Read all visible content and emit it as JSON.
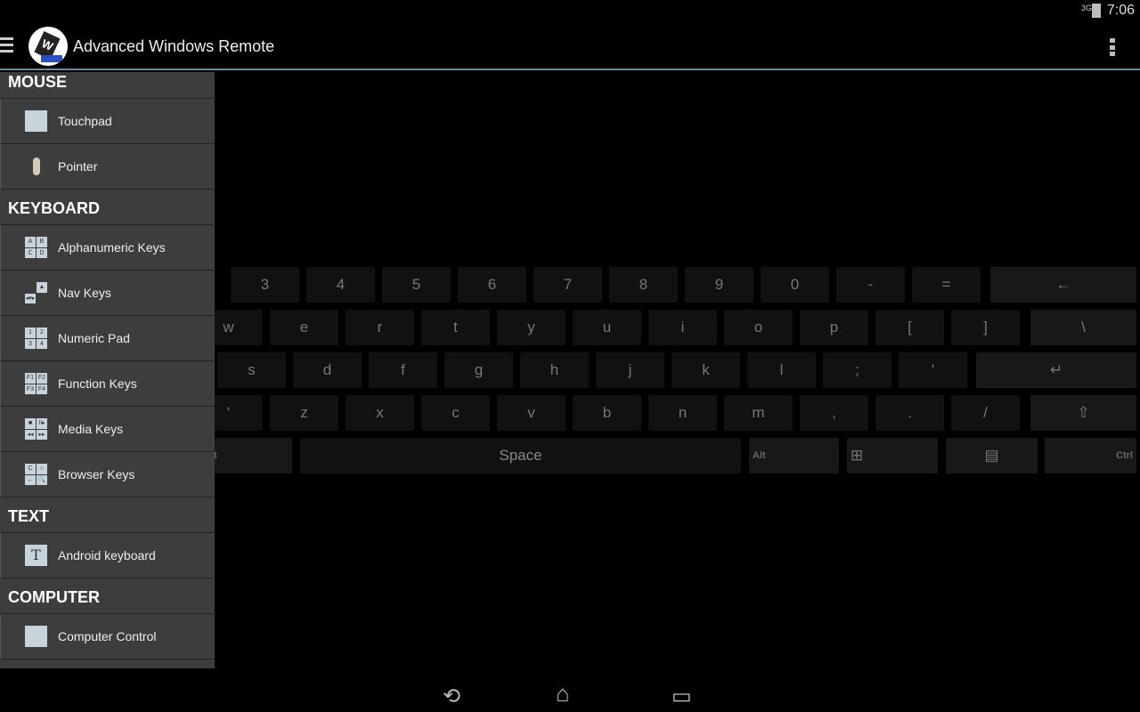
{
  "status": {
    "network": "3G",
    "time": "7:06"
  },
  "app": {
    "title": "Advanced Windows Remote",
    "logo_letter": "W"
  },
  "keyboard": {
    "row1": [
      "3",
      "4",
      "5",
      "6",
      "7",
      "8",
      "9",
      "0",
      "-",
      "="
    ],
    "row1_end": "←",
    "row2": [
      "w",
      "e",
      "r",
      "t",
      "y",
      "u",
      "i",
      "o",
      "p",
      "[",
      "]"
    ],
    "row2_end": "\\",
    "row3": [
      "s",
      "d",
      "f",
      "g",
      "h",
      "j",
      "k",
      "l",
      ";",
      "'"
    ],
    "row3_end": "↵",
    "row4": [
      "'",
      "z",
      "x",
      "c",
      "v",
      "b",
      "n",
      "m",
      ",",
      ".",
      "/"
    ],
    "row4_end": "⇧",
    "row5": {
      "left_partial": "t",
      "space": "Space",
      "alt": "Alt",
      "win": "⊞",
      "menu": "▤",
      "ctrl": "Ctrl"
    }
  },
  "sidebar": {
    "sections": [
      {
        "title": "MOUSE",
        "items": [
          {
            "label": "Touchpad",
            "icon": "touchpad-icon"
          },
          {
            "label": "Pointer",
            "icon": "pointer-icon"
          }
        ]
      },
      {
        "title": "KEYBOARD",
        "items": [
          {
            "label": "Alphanumeric Keys",
            "icon": "alphanumeric-icon",
            "glyphs": [
              "A",
              "B",
              "C",
              "D"
            ]
          },
          {
            "label": "Nav Keys",
            "icon": "nav-keys-icon",
            "glyphs": [
              "",
              "▲",
              "◂▾▸",
              ""
            ]
          },
          {
            "label": "Numeric Pad",
            "icon": "numeric-pad-icon",
            "glyphs": [
              "1",
              "2",
              "3",
              "4"
            ]
          },
          {
            "label": "Function Keys",
            "icon": "function-keys-icon",
            "glyphs": [
              "F1",
              "F2",
              "F3",
              "F4"
            ]
          },
          {
            "label": "Media Keys",
            "icon": "media-keys-icon",
            "glyphs": [
              "■",
              "II▸",
              "◂◂",
              "▸▸"
            ]
          },
          {
            "label": "Browser Keys",
            "icon": "browser-keys-icon",
            "glyphs": [
              "C",
              "⌂",
              "←",
              "🔍"
            ]
          }
        ]
      },
      {
        "title": "TEXT",
        "items": [
          {
            "label": "Android keyboard",
            "icon": "text-t-icon",
            "glyphs": [
              "T"
            ]
          }
        ]
      },
      {
        "title": "COMPUTER",
        "items": [
          {
            "label": "Computer Control",
            "icon": "computer-icon"
          }
        ]
      }
    ]
  },
  "navbar": {
    "back": "⟲",
    "home": "⌂",
    "recents": "▭"
  }
}
